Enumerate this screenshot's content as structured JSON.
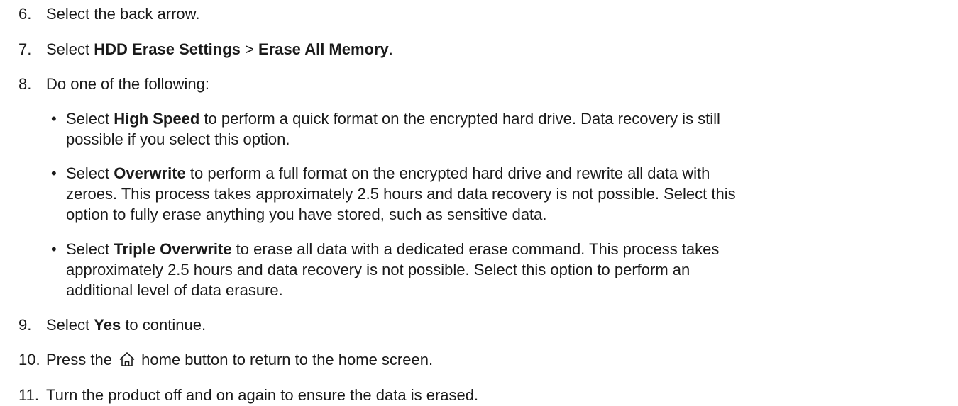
{
  "steps": [
    {
      "num": "6.",
      "text": "Select the back arrow."
    },
    {
      "num": "7.",
      "pre": "Select ",
      "bold1": "HDD Erase Settings",
      "mid": " > ",
      "bold2": "Erase All Memory",
      "post": "."
    },
    {
      "num": "8.",
      "text": "Do one of the following:"
    },
    {
      "num": "9.",
      "pre": "Select ",
      "bold": "Yes",
      "post": " to continue."
    },
    {
      "num": "10.",
      "pre": "Press the ",
      "icon": "home-icon",
      "post": " home button to return to the home screen."
    },
    {
      "num": "11.",
      "text": "Turn the product off and on again to ensure the data is erased."
    }
  ],
  "options": [
    {
      "bullet": "•",
      "pre": "Select ",
      "bold": "High Speed",
      "lines": [
        " to perform a quick format on the encrypted hard drive. Data recovery is still",
        "possible if you select this option."
      ]
    },
    {
      "bullet": "•",
      "pre": "Select ",
      "bold": "Overwrite",
      "lines": [
        " to perform a full format on the encrypted hard drive and rewrite all data with",
        "zeroes. This process takes approximately 2.5 hours and data recovery is not possible. Select this",
        "option to fully erase anything you have stored, such as sensitive data."
      ]
    },
    {
      "bullet": "•",
      "pre": "Select ",
      "bold": "Triple Overwrite",
      "lines": [
        " to erase all data with a dedicated erase command. This process takes",
        "approximately 2.5 hours and data recovery is not possible. Select this option to perform an",
        "additional level of data erasure."
      ]
    }
  ]
}
